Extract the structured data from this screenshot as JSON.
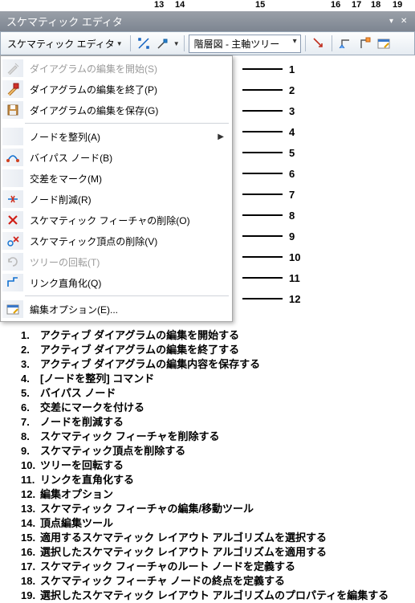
{
  "title": "スケマティック エディタ",
  "toolbar_label": "スケマティック エディタ",
  "combo_value": "階層図 - 主軸ツリー",
  "top_labels": {
    "l13": "13",
    "l14": "14",
    "l15": "15",
    "l16": "16",
    "l17": "17",
    "l18": "18",
    "l19": "19"
  },
  "menu": {
    "start_edit": "ダイアグラムの編集を開始(S)",
    "end_edit": "ダイアグラムの編集を終了(P)",
    "save_edit": "ダイアグラムの編集を保存(G)",
    "align_nodes": "ノードを整列(A)",
    "bypass_node": "バイパス ノード(B)",
    "mark_cross": "交差をマーク(M)",
    "reduce_node": "ノード削減(R)",
    "delete_feature": "スケマティック フィーチャの削除(O)",
    "delete_vertex": "スケマティック頂点の削除(V)",
    "rotate_tree": "ツリーの回転(T)",
    "square_link": "リンク直角化(Q)",
    "edit_options": "編集オプション(E)..."
  },
  "right_numbers": [
    "1",
    "2",
    "3",
    "4",
    "5",
    "6",
    "7",
    "8",
    "9",
    "10",
    "11",
    "12"
  ],
  "bottom": [
    {
      "n": "1.",
      "t": "アクティブ ダイアグラムの編集を開始する"
    },
    {
      "n": "2.",
      "t": "アクティブ ダイアグラムの編集を終了する"
    },
    {
      "n": "3.",
      "t": "アクティブ ダイアグラムの編集内容を保存する"
    },
    {
      "n": "4.",
      "t": "[ノードを整列] コマンド"
    },
    {
      "n": "5.",
      "t": "バイパス ノード"
    },
    {
      "n": "6.",
      "t": "交差にマークを付ける"
    },
    {
      "n": "7.",
      "t": "ノードを削減する"
    },
    {
      "n": "8.",
      "t": "スケマティック フィーチャを削除する"
    },
    {
      "n": "9.",
      "t": "スケマティック頂点を削除する"
    },
    {
      "n": "10.",
      "t": "ツリーを回転する"
    },
    {
      "n": "11.",
      "t": "リンクを直角化する"
    },
    {
      "n": "12.",
      "t": "編集オプション"
    },
    {
      "n": "13.",
      "t": "スケマティック フィーチャの編集/移動ツール"
    },
    {
      "n": "14.",
      "t": "頂点編集ツール"
    },
    {
      "n": "15.",
      "t": "適用するスケマティック レイアウト アルゴリズムを選択する"
    },
    {
      "n": "16.",
      "t": "選択したスケマティック レイアウト アルゴリズムを適用する"
    },
    {
      "n": "17.",
      "t": "スケマティック フィーチャのルート ノードを定義する"
    },
    {
      "n": "18.",
      "t": "スケマティック フィーチャ ノードの終点を定義する"
    },
    {
      "n": "19.",
      "t": "選択したスケマティック レイアウト アルゴリズムのプロパティを編集する"
    }
  ]
}
